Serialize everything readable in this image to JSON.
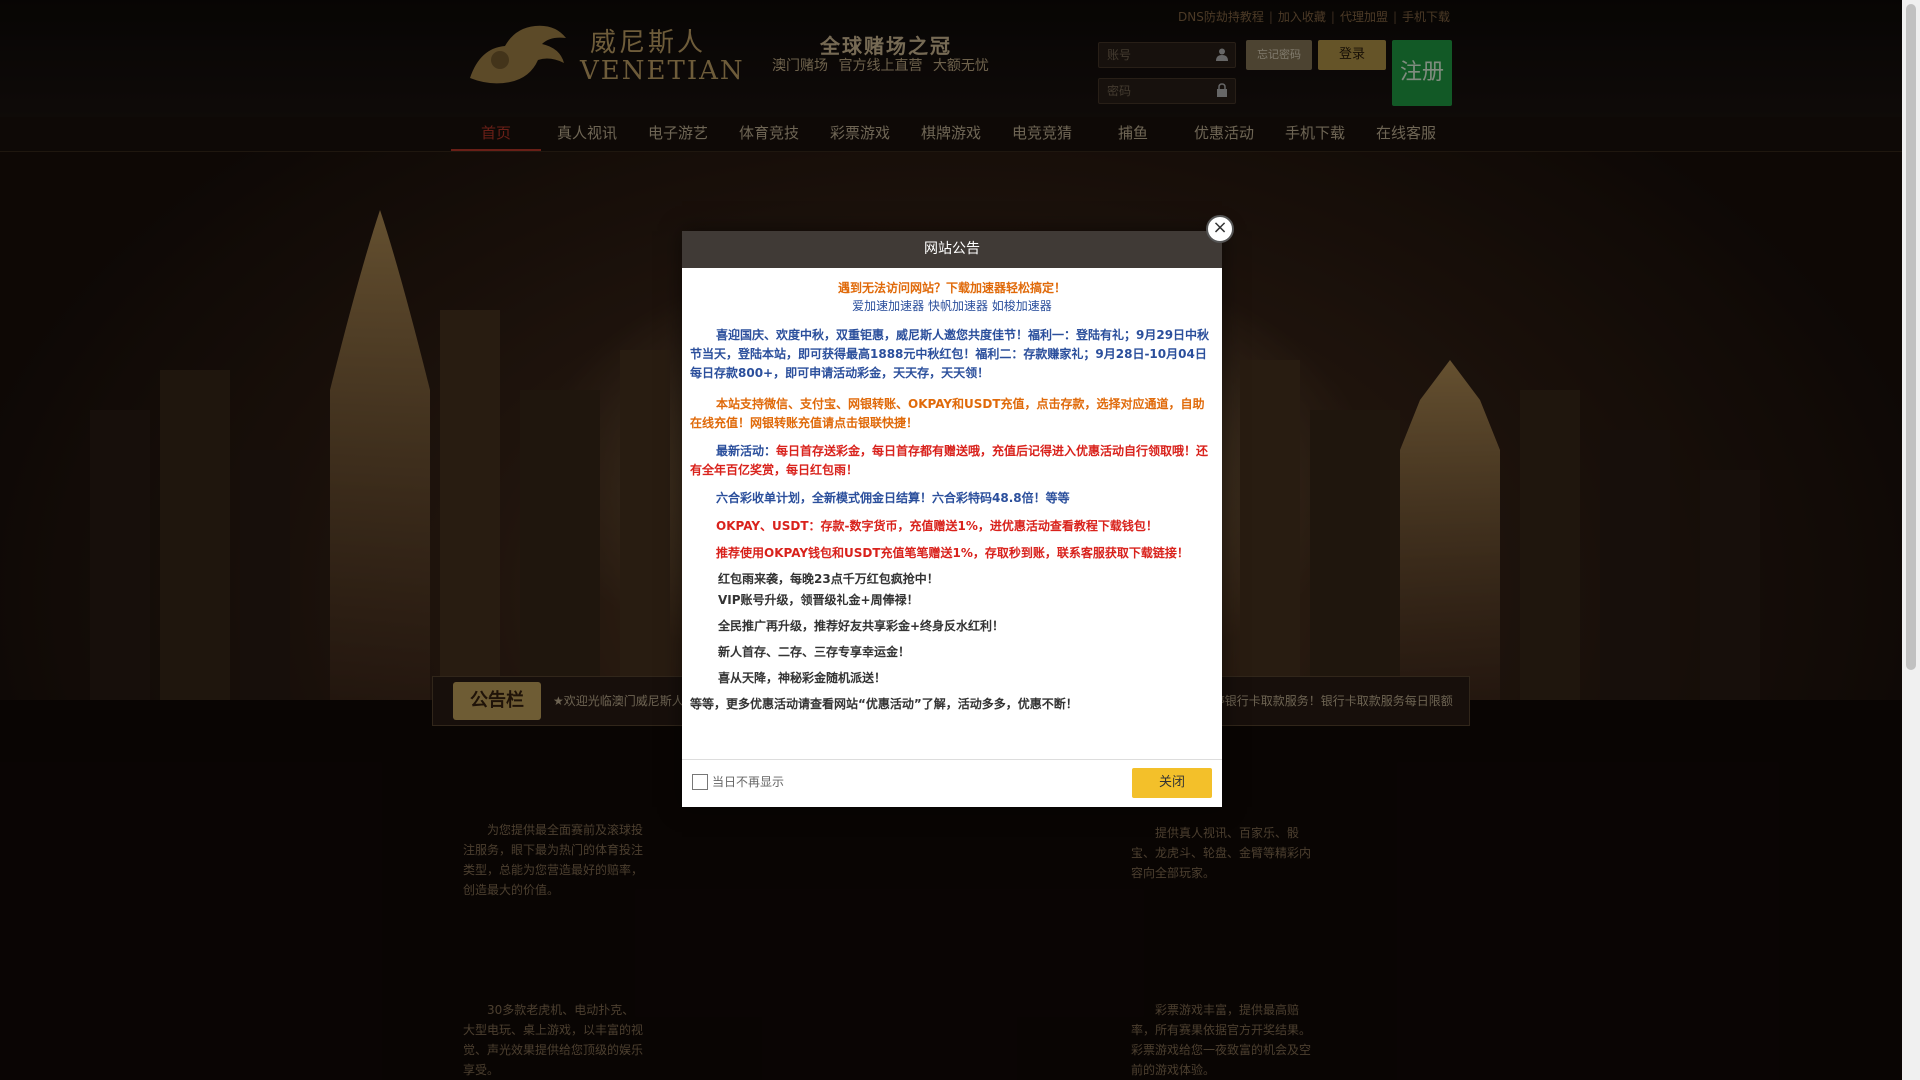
{
  "header": {
    "logo_cn": "威尼斯人",
    "logo_en": "VENETIAN",
    "slogan_main": "全球赌场之冠",
    "slogan_sub": "澳门赌场 官方线上直营 大额无忧",
    "top_links": [
      "DNS防劫持教程",
      "加入收藏",
      "代理加盟",
      "手机下载"
    ],
    "account_placeholder": "账号",
    "password_placeholder": "密码",
    "forgot_label": "忘记密码",
    "login_label": "登录",
    "register_label": "注册"
  },
  "nav": {
    "items": [
      "首页",
      "真人视讯",
      "电子游艺",
      "体育竞技",
      "彩票游戏",
      "棋牌游戏",
      "电竞竞猜",
      "捕鱼",
      "优惠活动",
      "手机下载",
      "在线客服"
    ]
  },
  "notice": {
    "tag": "公告栏",
    "text_left": "★欢迎光临澳门威尼斯人",
    "text_right": "出款至早上10点，暂停银行卡取款服务！银行卡取款服务每日限额"
  },
  "descriptions": {
    "sports": "为您提供最全面赛前及滚球投注服务，眼下最为热门的体育投注类型，总能为您营造最好的赔率，创造最大的价值。",
    "live": "提供真人视讯、百家乐、骰宝、龙虎斗、轮盘、金臂等精彩内容向全部玩家。",
    "slots": "30多款老虎机、电动扑克、大型电玩、桌上游戏，以丰富的视觉、声光效果提供给您顶级的娱乐享受。",
    "lottery": "彩票游戏丰富，提供最高赔率，所有赛果依据官方开奖结果。彩票游戏给您一夜致富的机会及空前的游戏体验。"
  },
  "modal": {
    "title": "网站公告",
    "close_icon": "×",
    "line1": "遇到无法访问网站？下载加速器轻松搞定！",
    "line2": "爱加速加速器  快帆加速器  如梭加速器",
    "p1": "喜迎国庆、欢度中秋，双重钜惠，威尼斯人邀您共度佳节！福利一：登陆有礼；9月29日中秋节当天，登陆本站，即可获得最高1888元中秋红包！福利二：存款赚家礼；9月28日-10月04日每日存款800+，即可申请活动彩金，天天存，天天领！",
    "p2": "本站支持微信、支付宝、网银转账、OKPAY和USDT充值，点击存款，选择对应通道，自助在线充值！网银转账充值请点击银联快捷！",
    "p3a": "最新活动：",
    "p3b": "每日首存送彩金，每日首存都有赠送哦，充值后记得进入优惠活动自行领取哦！还有全年百亿奖赏，每日红包雨！",
    "p4": "六合彩收单计划，全新模式佣金日结算！六合彩特码48.8倍！等等",
    "p5": "OKPAY、USDT：存款-数字货币，充值赠送1%，进优惠活动查看教程下载钱包！",
    "p6": "推荐使用OKPAY钱包和USDT充值笔笔赠送1%，存取秒到账，联系客服获取下载链接！",
    "b1": "红包雨来袭，每晚23点千万红包疯抢中！",
    "b2": "VIP账号升级，领晋级礼金+周俸禄！",
    "b3": "全民推广再升级，推荐好友共享彩金+终身反水红利！",
    "b4": "新人首存、二存、三存专享幸运金！",
    "b5": "喜从天降，神秘彩金随机派送！",
    "footer_note": "等等，更多优惠活动请查看网站“优惠活动”了解，活动多多，优惠不断！",
    "checkbox_label": "当日不再显示",
    "close_button": "关闭"
  }
}
